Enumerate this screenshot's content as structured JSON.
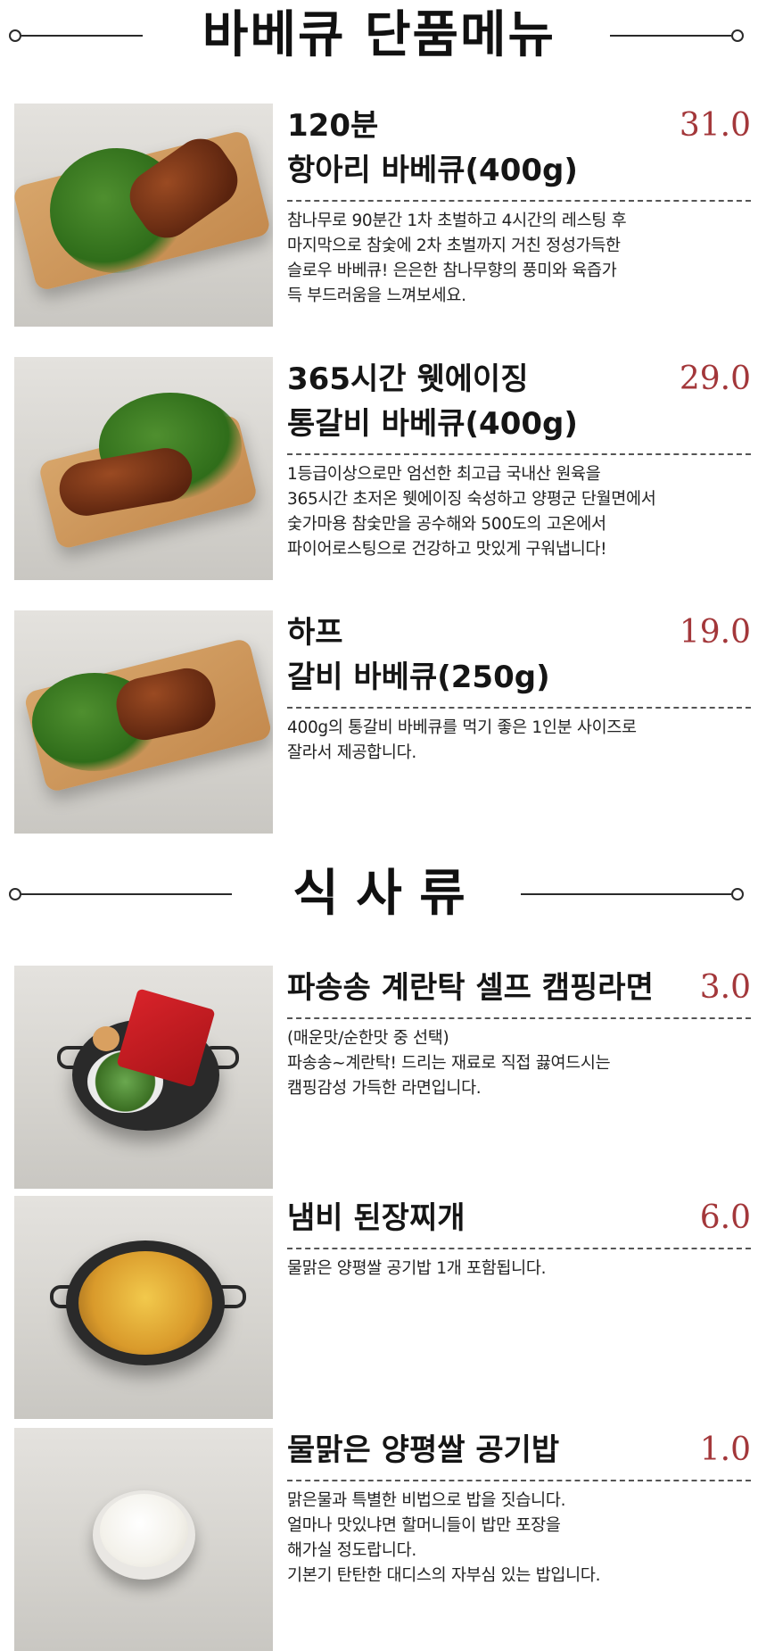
{
  "sections": [
    {
      "title": "바베큐 단품메뉴",
      "items": [
        {
          "name": "120분\n항아리 바베큐(400g)",
          "price": "31.0",
          "description": "참나무로 90분간 1차 초벌하고 4시간의 레스팅 후\n마지막으로 참숯에 2차 초벌까지 거친 정성가득한\n슬로우 바베큐! 은은한 참나무향의 풍미와 육즙가\n득 부드러움을 느껴보세요."
        },
        {
          "name": "365시간 웻에이징\n통갈비 바베큐(400g)",
          "price": "29.0",
          "description": "1등급이상으로만 엄선한 최고급 국내산 원육을\n365시간 초저온 웻에이징 숙성하고 양평군 단월면에서\n숯가마용 참숯만을 공수해와 500도의 고온에서\n파이어로스팅으로 건강하고 맛있게 구워냅니다!"
        },
        {
          "name": "하프\n갈비 바베큐(250g)",
          "price": "19.0",
          "description": "400g의 통갈비 바베큐를 먹기 좋은 1인분 사이즈로\n잘라서 제공합니다."
        }
      ]
    },
    {
      "title": "식 사 류",
      "items": [
        {
          "name": "파송송 계란탁 셀프 캠핑라면",
          "price": "3.0",
          "description": "(매운맛/순한맛 중 선택)\n파송송~계란탁! 드리는 재료로 직접 끓여드시는\n캠핑감성 가득한 라면입니다."
        },
        {
          "name": "냄비 된장찌개",
          "price": "6.0",
          "description": "물맑은 양평쌀 공기밥 1개 포함됩니다."
        },
        {
          "name": "물맑은 양평쌀 공기밥",
          "price": "1.0",
          "description": "맑은물과 특별한 비법으로 밥을 짓습니다.\n얼마나 맛있냐면 할머니들이 밥만 포장을\n해가실 정도랍니다.\n기본기 탄탄한 대디스의 자부심 있는 밥입니다."
        }
      ]
    }
  ]
}
